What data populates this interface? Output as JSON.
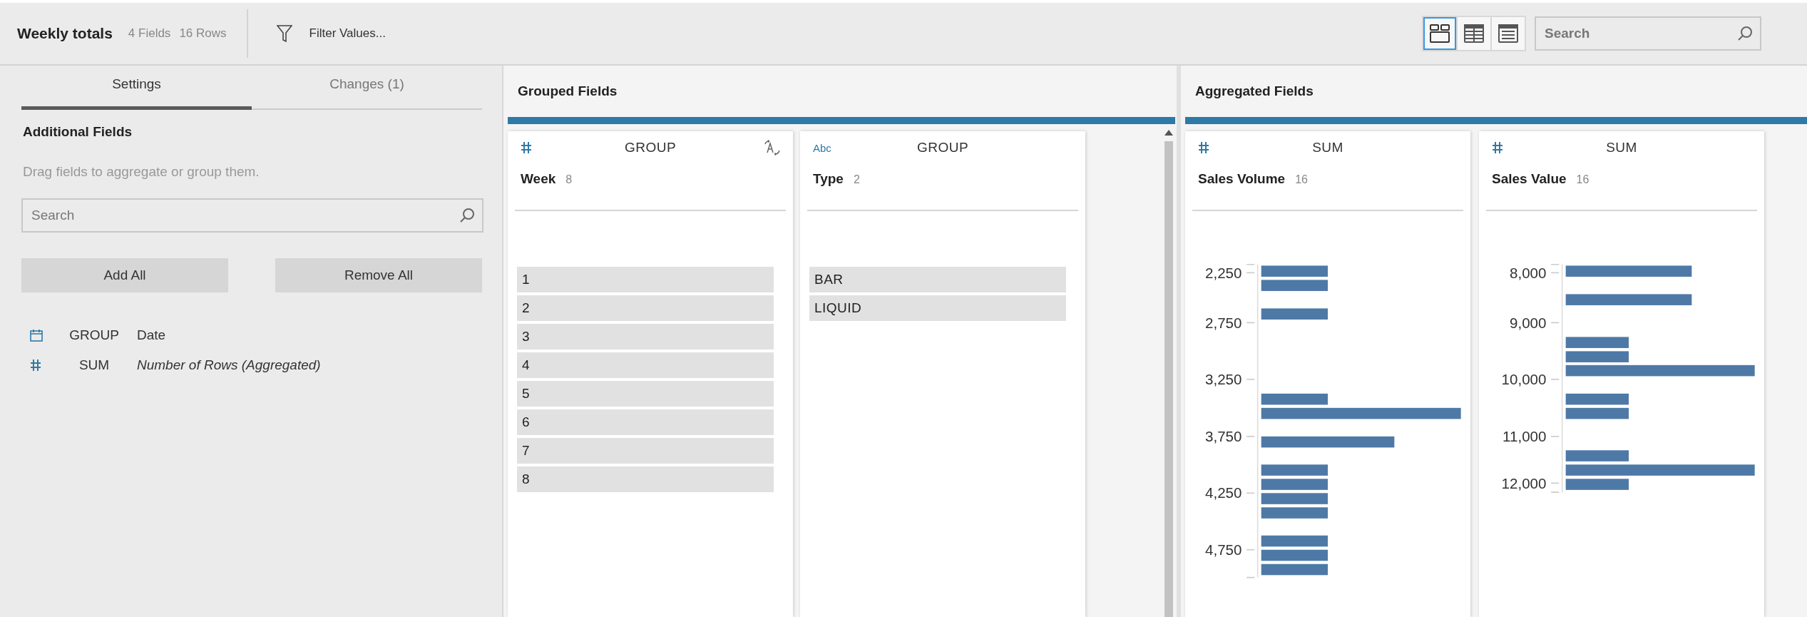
{
  "toolbar": {
    "title": "Weekly totals",
    "fields_count": "4 Fields",
    "rows_count": "16 Rows",
    "filter_button": "Filter Values...",
    "view_modes": [
      {
        "kind": "cards",
        "selected": true
      },
      {
        "kind": "grid",
        "selected": false
      },
      {
        "kind": "list",
        "selected": false
      }
    ],
    "search": {
      "placeholder": "Search"
    }
  },
  "settings_panel": {
    "tabs": [
      {
        "label": "Settings",
        "selected": true
      },
      {
        "label": "Changes (1)",
        "selected": false
      }
    ],
    "section_title": "Additional Fields",
    "hint": "Drag fields to aggregate or group them.",
    "search": {
      "placeholder": "Search"
    },
    "buttons": [
      "Add All",
      "Remove All"
    ],
    "fields": [
      {
        "kind": "date",
        "aggregation": "GROUP",
        "name": "Date",
        "italic": false
      },
      {
        "kind": "number",
        "aggregation": "SUM",
        "name": "Number of Rows (Aggregated)",
        "italic": true
      }
    ]
  },
  "grouped_fields": {
    "title": "Grouped Fields",
    "cards": [
      {
        "kind": "number",
        "aggregation": "GROUP",
        "name": "Week",
        "count": "8",
        "convertible": true,
        "values": [
          "1",
          "2",
          "3",
          "4",
          "5",
          "6",
          "7",
          "8"
        ]
      },
      {
        "kind": "string",
        "type_label": "Abc",
        "aggregation": "GROUP",
        "name": "Type",
        "count": "2",
        "convertible": false,
        "values": [
          "BAR",
          "LIQUID"
        ]
      }
    ]
  },
  "aggregated_fields": {
    "title": "Aggregated Fields",
    "cards": [
      {
        "kind": "number",
        "aggregation": "SUM",
        "name": "Sales Volume",
        "count": "16",
        "axis_labels": [
          "2,250",
          "2,750",
          "3,250",
          "3,750",
          "4,250",
          "4,750"
        ]
      },
      {
        "kind": "number",
        "aggregation": "SUM",
        "name": "Sales Value",
        "count": "16",
        "axis_labels": [
          "8,000",
          "9,000",
          "10,000",
          "11,000",
          "12,000"
        ]
      }
    ]
  }
}
